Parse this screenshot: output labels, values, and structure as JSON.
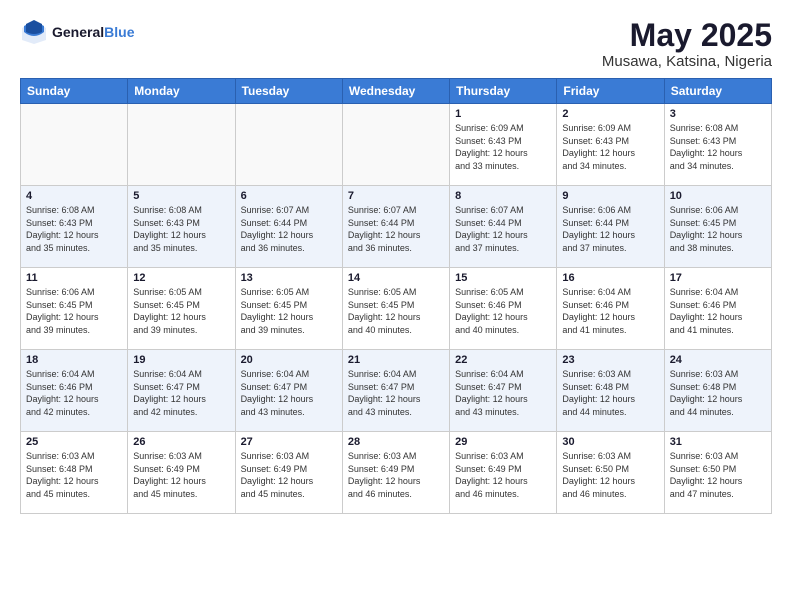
{
  "header": {
    "logo_line1": "General",
    "logo_line2": "Blue",
    "title": "May 2025",
    "subtitle": "Musawa, Katsina, Nigeria"
  },
  "days_of_week": [
    "Sunday",
    "Monday",
    "Tuesday",
    "Wednesday",
    "Thursday",
    "Friday",
    "Saturday"
  ],
  "weeks": [
    [
      {
        "day": "",
        "info": ""
      },
      {
        "day": "",
        "info": ""
      },
      {
        "day": "",
        "info": ""
      },
      {
        "day": "",
        "info": ""
      },
      {
        "day": "1",
        "info": "Sunrise: 6:09 AM\nSunset: 6:43 PM\nDaylight: 12 hours\nand 33 minutes."
      },
      {
        "day": "2",
        "info": "Sunrise: 6:09 AM\nSunset: 6:43 PM\nDaylight: 12 hours\nand 34 minutes."
      },
      {
        "day": "3",
        "info": "Sunrise: 6:08 AM\nSunset: 6:43 PM\nDaylight: 12 hours\nand 34 minutes."
      }
    ],
    [
      {
        "day": "4",
        "info": "Sunrise: 6:08 AM\nSunset: 6:43 PM\nDaylight: 12 hours\nand 35 minutes."
      },
      {
        "day": "5",
        "info": "Sunrise: 6:08 AM\nSunset: 6:43 PM\nDaylight: 12 hours\nand 35 minutes."
      },
      {
        "day": "6",
        "info": "Sunrise: 6:07 AM\nSunset: 6:44 PM\nDaylight: 12 hours\nand 36 minutes."
      },
      {
        "day": "7",
        "info": "Sunrise: 6:07 AM\nSunset: 6:44 PM\nDaylight: 12 hours\nand 36 minutes."
      },
      {
        "day": "8",
        "info": "Sunrise: 6:07 AM\nSunset: 6:44 PM\nDaylight: 12 hours\nand 37 minutes."
      },
      {
        "day": "9",
        "info": "Sunrise: 6:06 AM\nSunset: 6:44 PM\nDaylight: 12 hours\nand 37 minutes."
      },
      {
        "day": "10",
        "info": "Sunrise: 6:06 AM\nSunset: 6:45 PM\nDaylight: 12 hours\nand 38 minutes."
      }
    ],
    [
      {
        "day": "11",
        "info": "Sunrise: 6:06 AM\nSunset: 6:45 PM\nDaylight: 12 hours\nand 39 minutes."
      },
      {
        "day": "12",
        "info": "Sunrise: 6:05 AM\nSunset: 6:45 PM\nDaylight: 12 hours\nand 39 minutes."
      },
      {
        "day": "13",
        "info": "Sunrise: 6:05 AM\nSunset: 6:45 PM\nDaylight: 12 hours\nand 39 minutes."
      },
      {
        "day": "14",
        "info": "Sunrise: 6:05 AM\nSunset: 6:45 PM\nDaylight: 12 hours\nand 40 minutes."
      },
      {
        "day": "15",
        "info": "Sunrise: 6:05 AM\nSunset: 6:46 PM\nDaylight: 12 hours\nand 40 minutes."
      },
      {
        "day": "16",
        "info": "Sunrise: 6:04 AM\nSunset: 6:46 PM\nDaylight: 12 hours\nand 41 minutes."
      },
      {
        "day": "17",
        "info": "Sunrise: 6:04 AM\nSunset: 6:46 PM\nDaylight: 12 hours\nand 41 minutes."
      }
    ],
    [
      {
        "day": "18",
        "info": "Sunrise: 6:04 AM\nSunset: 6:46 PM\nDaylight: 12 hours\nand 42 minutes."
      },
      {
        "day": "19",
        "info": "Sunrise: 6:04 AM\nSunset: 6:47 PM\nDaylight: 12 hours\nand 42 minutes."
      },
      {
        "day": "20",
        "info": "Sunrise: 6:04 AM\nSunset: 6:47 PM\nDaylight: 12 hours\nand 43 minutes."
      },
      {
        "day": "21",
        "info": "Sunrise: 6:04 AM\nSunset: 6:47 PM\nDaylight: 12 hours\nand 43 minutes."
      },
      {
        "day": "22",
        "info": "Sunrise: 6:04 AM\nSunset: 6:47 PM\nDaylight: 12 hours\nand 43 minutes."
      },
      {
        "day": "23",
        "info": "Sunrise: 6:03 AM\nSunset: 6:48 PM\nDaylight: 12 hours\nand 44 minutes."
      },
      {
        "day": "24",
        "info": "Sunrise: 6:03 AM\nSunset: 6:48 PM\nDaylight: 12 hours\nand 44 minutes."
      }
    ],
    [
      {
        "day": "25",
        "info": "Sunrise: 6:03 AM\nSunset: 6:48 PM\nDaylight: 12 hours\nand 45 minutes."
      },
      {
        "day": "26",
        "info": "Sunrise: 6:03 AM\nSunset: 6:49 PM\nDaylight: 12 hours\nand 45 minutes."
      },
      {
        "day": "27",
        "info": "Sunrise: 6:03 AM\nSunset: 6:49 PM\nDaylight: 12 hours\nand 45 minutes."
      },
      {
        "day": "28",
        "info": "Sunrise: 6:03 AM\nSunset: 6:49 PM\nDaylight: 12 hours\nand 46 minutes."
      },
      {
        "day": "29",
        "info": "Sunrise: 6:03 AM\nSunset: 6:49 PM\nDaylight: 12 hours\nand 46 minutes."
      },
      {
        "day": "30",
        "info": "Sunrise: 6:03 AM\nSunset: 6:50 PM\nDaylight: 12 hours\nand 46 minutes."
      },
      {
        "day": "31",
        "info": "Sunrise: 6:03 AM\nSunset: 6:50 PM\nDaylight: 12 hours\nand 47 minutes."
      }
    ]
  ]
}
